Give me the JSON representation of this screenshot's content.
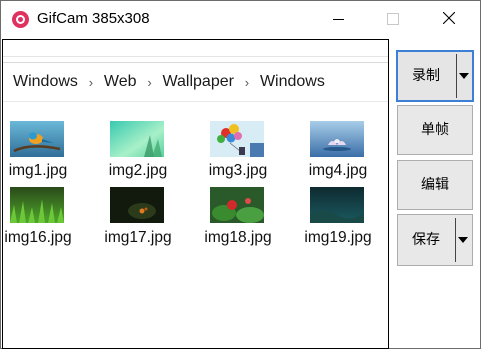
{
  "window": {
    "title": "GifCam 385x308",
    "accent_color": "#e0325f"
  },
  "capture": {
    "breadcrumb": [
      "Windows",
      "Web",
      "Wallpaper",
      "Windows"
    ],
    "files": [
      {
        "name": "img1.jpg"
      },
      {
        "name": "img2.jpg"
      },
      {
        "name": "img3.jpg"
      },
      {
        "name": "img4.jpg"
      },
      {
        "name": "img16.jpg"
      },
      {
        "name": "img17.jpg"
      },
      {
        "name": "img18.jpg"
      },
      {
        "name": "img19.jpg"
      }
    ]
  },
  "toolbar": {
    "record_label": "录制",
    "frame_label": "单帧",
    "edit_label": "编辑",
    "save_label": "保存",
    "record_focus_color": "#3c7fd4"
  }
}
